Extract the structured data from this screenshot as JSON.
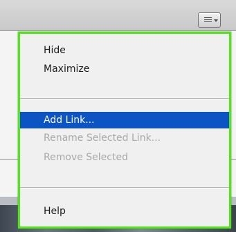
{
  "flyout_menu": {
    "items": [
      {
        "label": "Hide",
        "enabled": true
      },
      {
        "label": "Maximize",
        "enabled": true
      },
      {
        "label": "Add Link...",
        "enabled": true,
        "highlighted": true
      },
      {
        "label": "Rename Selected Link...",
        "enabled": false
      },
      {
        "label": "Remove Selected",
        "enabled": false
      },
      {
        "label": "Help",
        "enabled": true
      }
    ],
    "border_color": "#55e21f",
    "highlight_color": "#0c53c4"
  },
  "panel_menu_button": {
    "icon": "panel-menu-icon"
  }
}
